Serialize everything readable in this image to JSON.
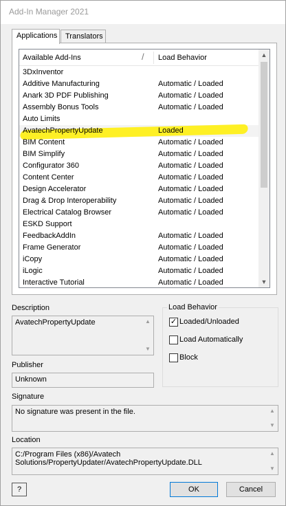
{
  "window": {
    "title": "Add-In Manager 2021"
  },
  "tabs": [
    {
      "label": "Applications",
      "active": true
    },
    {
      "label": "Translators",
      "active": false
    }
  ],
  "list": {
    "columns": {
      "name": "Available Add-Ins",
      "behavior": "Load Behavior"
    },
    "selected_index": 5,
    "rows": [
      {
        "name": "3DxInventor",
        "behavior": ""
      },
      {
        "name": "Additive Manufacturing",
        "behavior": "Automatic / Loaded"
      },
      {
        "name": "Anark 3D PDF Publishing",
        "behavior": "Automatic / Loaded"
      },
      {
        "name": "Assembly Bonus Tools",
        "behavior": "Automatic / Loaded"
      },
      {
        "name": "Auto Limits",
        "behavior": ""
      },
      {
        "name": "AvatechPropertyUpdate",
        "behavior": "Loaded"
      },
      {
        "name": "BIM Content",
        "behavior": "Automatic / Loaded"
      },
      {
        "name": "BIM Simplify",
        "behavior": "Automatic / Loaded"
      },
      {
        "name": "Configurator 360",
        "behavior": "Automatic / Loaded"
      },
      {
        "name": "Content Center",
        "behavior": "Automatic / Loaded"
      },
      {
        "name": "Design Accelerator",
        "behavior": "Automatic / Loaded"
      },
      {
        "name": "Drag & Drop Interoperability",
        "behavior": "Automatic / Loaded"
      },
      {
        "name": "Electrical Catalog Browser",
        "behavior": "Automatic / Loaded"
      },
      {
        "name": "ESKD Support",
        "behavior": ""
      },
      {
        "name": "FeedbackAddIn",
        "behavior": "Automatic / Loaded"
      },
      {
        "name": "Frame Generator",
        "behavior": "Automatic / Loaded"
      },
      {
        "name": "iCopy",
        "behavior": "Automatic / Loaded"
      },
      {
        "name": "iLogic",
        "behavior": "Automatic / Loaded"
      },
      {
        "name": "Interactive Tutorial",
        "behavior": "Automatic / Loaded"
      }
    ]
  },
  "description": {
    "label": "Description",
    "value": "AvatechPropertyUpdate"
  },
  "publisher": {
    "label": "Publisher",
    "value": "Unknown"
  },
  "signature": {
    "label": "Signature",
    "value": "No signature was present in the file."
  },
  "location": {
    "label": "Location",
    "line1": "C:/Program Files (x86)/Avatech",
    "line2": "Solutions/PropertyUpdater/AvatechPropertyUpdate.DLL"
  },
  "load_behavior": {
    "legend": "Load Behavior",
    "options": [
      {
        "label": "Loaded/Unloaded",
        "checked": true
      },
      {
        "label": "Load Automatically",
        "checked": false
      },
      {
        "label": "Block",
        "checked": false
      }
    ]
  },
  "buttons": {
    "ok": "OK",
    "cancel": "Cancel",
    "help_glyph": "?"
  },
  "glyphs": {
    "check": "✓",
    "up": "▲",
    "down": "▼",
    "sort": "/"
  },
  "colors": {
    "highlight": "#ffee00",
    "title_text": "#9a9a9a"
  }
}
